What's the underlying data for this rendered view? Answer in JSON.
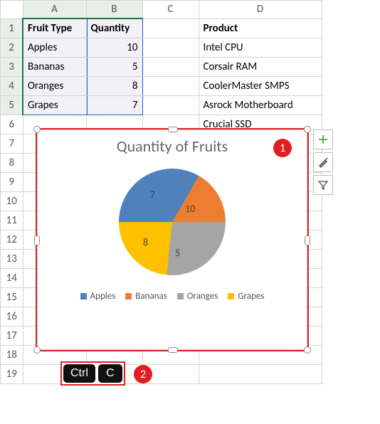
{
  "columns": [
    "A",
    "B",
    "C",
    "D"
  ],
  "rows": [
    "1",
    "2",
    "3",
    "4",
    "5",
    "6",
    "7",
    "8",
    "9",
    "10",
    "11",
    "12",
    "13",
    "14",
    "15",
    "16",
    "17",
    "18",
    "19"
  ],
  "grid": {
    "A1": "Fruit Type",
    "B1": "Quantity",
    "D1": "Product",
    "A2": "Apples",
    "B2": "10",
    "D2": "Intel CPU",
    "A3": "Bananas",
    "B3": "5",
    "D3": "Corsair RAM",
    "A4": "Oranges",
    "B4": "8",
    "D4": "CoolerMaster SMPS",
    "A5": "Grapes",
    "B5": "7",
    "D5": "Asrock Motherboard",
    "D6": "Crucial SSD"
  },
  "selection": {
    "range": "A1:B5"
  },
  "chart": {
    "title": "Quantity of Fruits"
  },
  "chart_data": {
    "type": "pie",
    "title": "Quantity of Fruits",
    "categories": [
      "Apples",
      "Bananas",
      "Oranges",
      "Grapes"
    ],
    "values": [
      10,
      5,
      8,
      7
    ],
    "colors": [
      "#4f81bd",
      "#ed7d31",
      "#a5a5a5",
      "#ffc000"
    ],
    "data_labels": [
      "10",
      "5",
      "8",
      "7"
    ],
    "legend_position": "bottom"
  },
  "callouts": {
    "one": "1",
    "two": "2"
  },
  "keys": {
    "ctrl": "Ctrl",
    "c": "C"
  },
  "legend": {
    "l0": "Apples",
    "l1": "Bananas",
    "l2": "Oranges",
    "l3": "Grapes"
  },
  "datalabels": {
    "d0": "10",
    "d1": "5",
    "d2": "8",
    "d3": "7"
  }
}
